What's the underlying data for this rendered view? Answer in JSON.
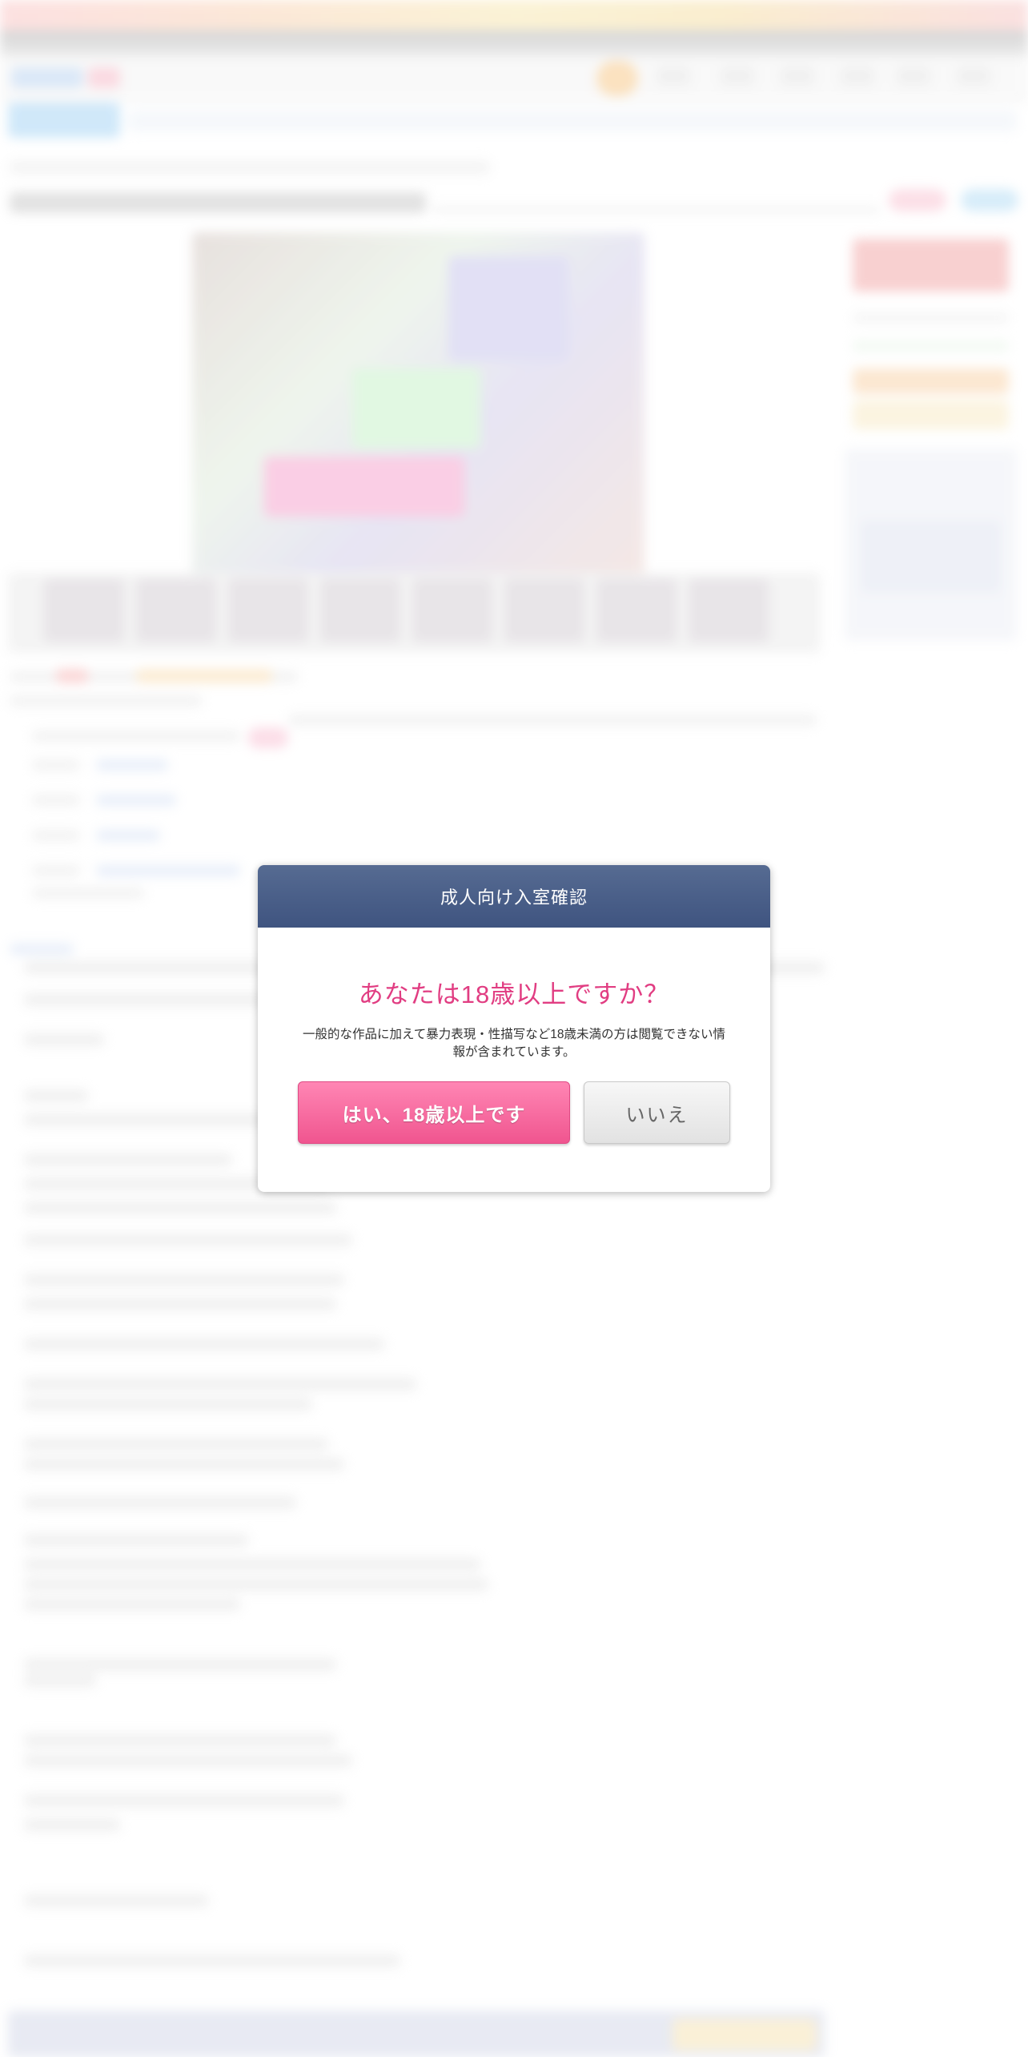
{
  "age_gate": {
    "title": "成人向け入室確認",
    "question": "あなたは18歳以上ですか？",
    "note": "一般的な作品に加えて暴力表現・性描写など18歳未満の方は閲覧できない情報が含まれています。",
    "yes_label": "はい、18歳以上です",
    "no_label": "いいえ"
  },
  "colors": {
    "header_bg": "#4a5e88",
    "question_text": "#e13d82",
    "yes_button": "#f6679c",
    "no_button": "#ebebeb"
  }
}
